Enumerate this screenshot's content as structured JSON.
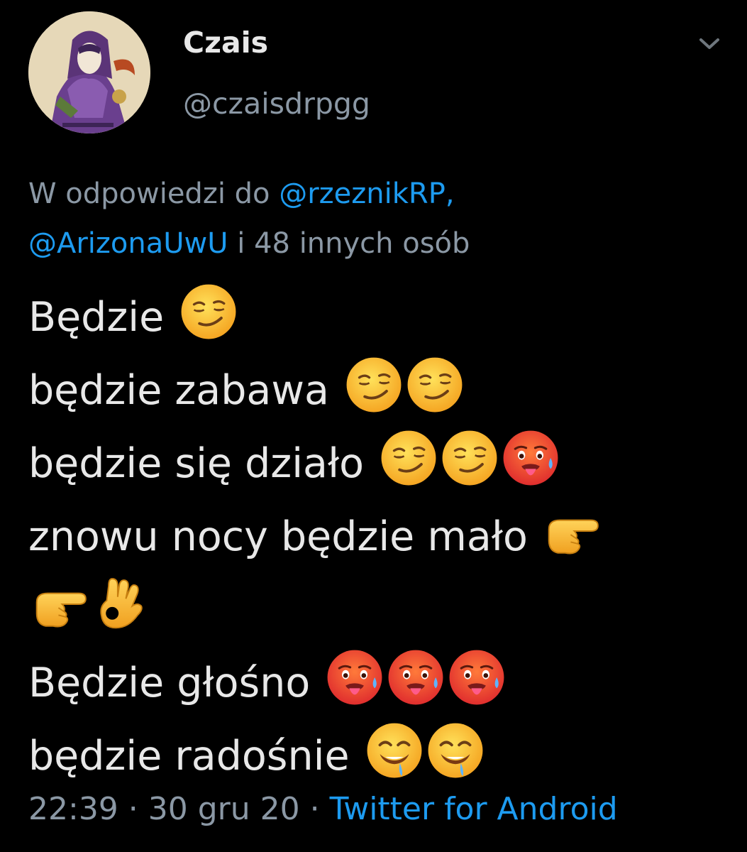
{
  "user": {
    "display_name": "Czais",
    "handle": "@czaisdrpgg"
  },
  "reply_context": {
    "prefix": "W odpowiedzi do ",
    "mention1": "@rzeznikRP,",
    "mention2": "@ArizonaUwU",
    "suffix": " i 48 innych osób"
  },
  "tweet": {
    "lines": [
      {
        "text": "Będzie",
        "emojis": [
          "smirking-face"
        ]
      },
      {
        "text": "będzie zabawa",
        "emojis": [
          "smirking-face",
          "smirking-face"
        ]
      },
      {
        "text": "będzie się działo",
        "emojis": [
          "smirking-face",
          "smirking-face",
          "hot-face"
        ]
      },
      {
        "text": "znowu nocy będzie mało",
        "emojis": [
          "backhand-index-pointing-right"
        ]
      },
      {
        "text": "",
        "emojis": [
          "backhand-index-pointing-right",
          "ok-hand"
        ]
      },
      {
        "text": "Będzie głośno",
        "emojis": [
          "hot-face",
          "hot-face",
          "hot-face"
        ]
      },
      {
        "text": "będzie radośnie",
        "emojis": [
          "drooling-face",
          "drooling-face"
        ]
      }
    ]
  },
  "meta": {
    "time": "22:39",
    "separator1": " · ",
    "date": "30 gru 20",
    "separator2": " · ",
    "source": "Twitter for Android"
  },
  "icons": {
    "menu": "chevron-down-icon",
    "avatar": "avatar"
  },
  "colors": {
    "background": "#000000",
    "text": "#e8e8e8",
    "secondary": "#8b98a5",
    "link": "#1d9bf0"
  }
}
